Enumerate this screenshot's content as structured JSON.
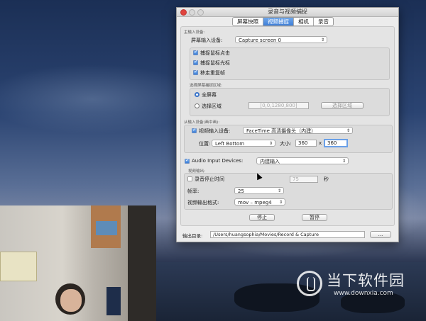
{
  "window": {
    "title": "录音与视频捕捉",
    "tabs": [
      "屏幕快照",
      "视频捕捉",
      "相机",
      "录音"
    ],
    "active_tab": 1
  },
  "main_input": {
    "group_label": "主输入设备:",
    "screen_device_label": "屏幕输入设备:",
    "screen_device_value": "Capture screen 0",
    "options": [
      {
        "label": "捕捉鼠标点击",
        "checked": true
      },
      {
        "label": "捕捉鼠标光标",
        "checked": true
      },
      {
        "label": "移走重复帧",
        "checked": true
      }
    ],
    "region_group_label": "选择屏幕捕捉区域:",
    "full_screen_label": "全屏幕",
    "select_region_label": "选择区域",
    "region_value": "[0,0,1280,800]",
    "select_region_button": "选择区域"
  },
  "secondary_input": {
    "group_label": "从输入设备(画中画):",
    "video_device_label": "视频输入设备:",
    "video_device_value": "FaceTime 高清摄像头（内建）",
    "position_label": "位置:",
    "position_value": "Left Bottom",
    "size_label": "大小:",
    "width": "360",
    "times": "x",
    "height": "360"
  },
  "audio": {
    "label": "Audio Input Devices:",
    "value": "内建输入",
    "checked": true
  },
  "video_output": {
    "group_label": "视频输出:",
    "stop_timer_label": "录音停止时间",
    "stop_timer_value": "75",
    "stop_timer_unit": "秒",
    "fps_label": "帧率:",
    "fps_value": "25",
    "format_label": "视频输出格式:",
    "format_value": "mov – mpeg4"
  },
  "buttons": {
    "stop": "停止",
    "pause": "暂停"
  },
  "output_dir": {
    "label": "输出目录:",
    "value": "/Users/huangsophia/Movies/Record & Capture",
    "browse": "..."
  },
  "watermark": {
    "brand": "当下软件园",
    "url": "www.downxia.com"
  }
}
